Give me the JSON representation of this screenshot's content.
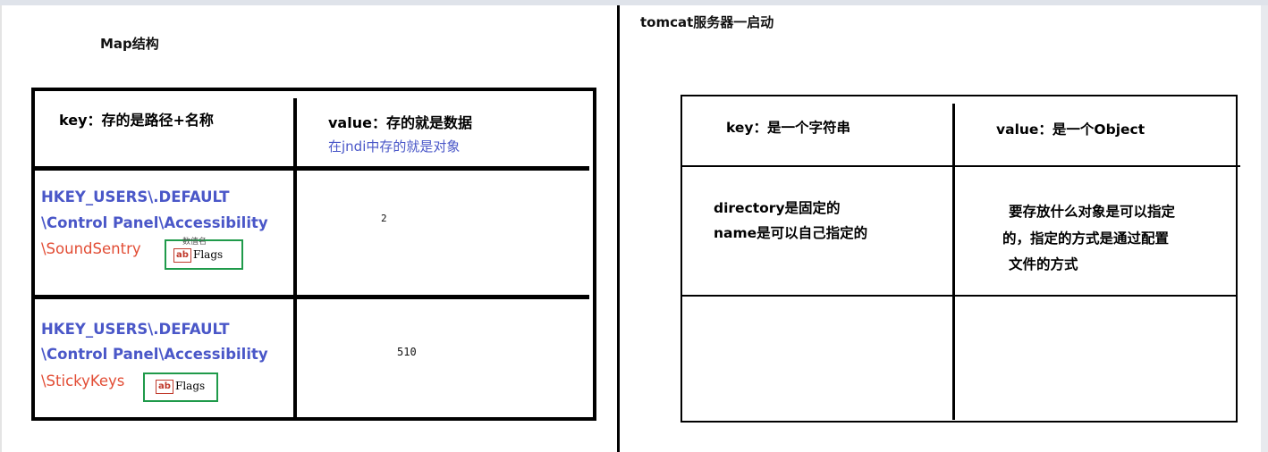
{
  "left": {
    "title": "Map结构",
    "header": {
      "key": "key：存的是路径+名称",
      "value": "value：存的就是数据",
      "value_note": "在jndi中存的就是对象"
    },
    "rows": [
      {
        "path_line1": "HKEY_USERS\\.DEFAULT",
        "path_line2": "\\Control Panel\\Accessibility",
        "key_name": "\\SoundSentry",
        "value_name": "Flags",
        "value_header": "数值名",
        "value": "2"
      },
      {
        "path_line1": "HKEY_USERS\\.DEFAULT",
        "path_line2": "\\Control Panel\\Accessibility",
        "key_name": "\\StickyKeys",
        "value_name": "Flags",
        "value": "510"
      }
    ]
  },
  "right": {
    "title": "tomcat服务器一启动",
    "header": {
      "key": "key：是一个字符串",
      "value": "value：是一个Object"
    },
    "row": {
      "key_line1": "directory是固定的",
      "key_line2": "name是可以自己指定的",
      "value_line1": "要存放什么对象是可以指定",
      "value_line2": "的，指定的方式是通过配置",
      "value_line3": "文件的方式"
    }
  },
  "icons": {
    "flag_icon_glyph": "ab"
  },
  "colors": {
    "path_blue": "#4a57c8",
    "key_red": "#e24d35",
    "note_blue": "#4a57c8",
    "flag_border_green": "#1f9a4a"
  }
}
